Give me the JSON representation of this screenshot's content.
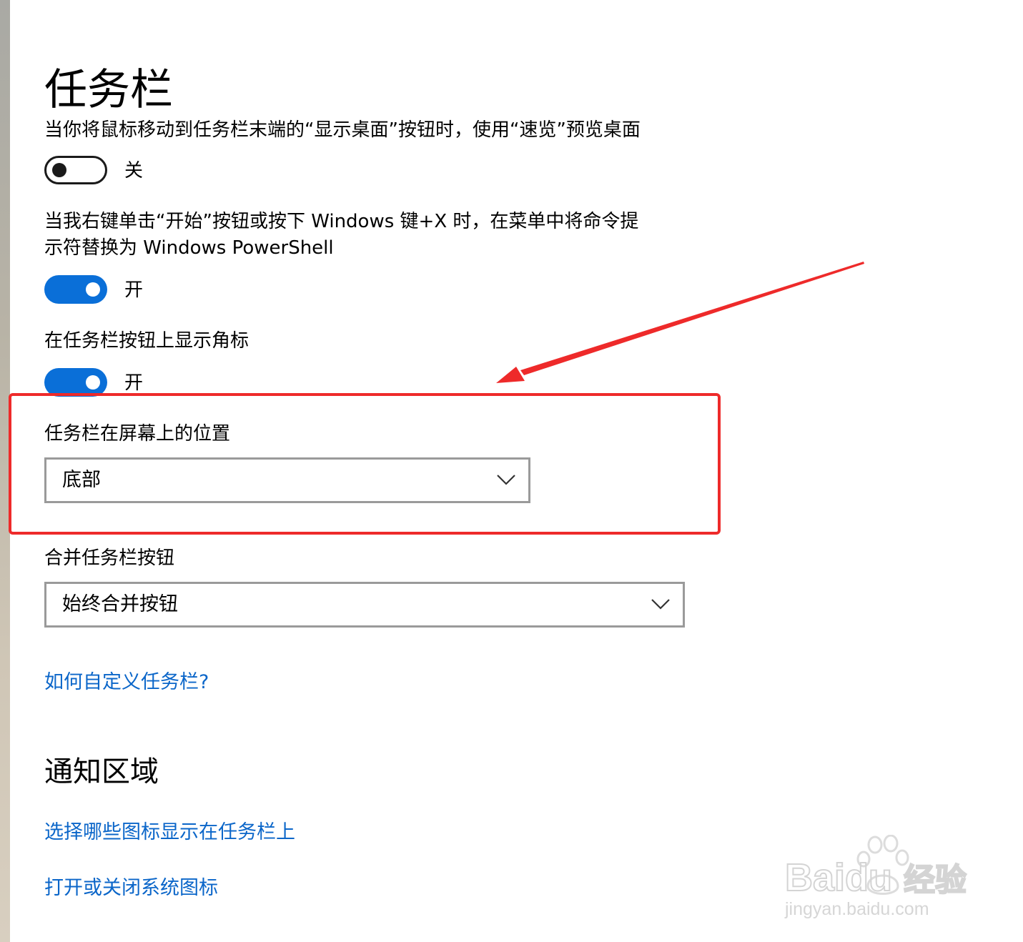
{
  "page": {
    "title": "任务栏"
  },
  "settings": {
    "peek": {
      "label": "当你将鼠标移动到任务栏末端的“显示桌面”按钮时，使用“速览”预览桌面",
      "state": "关",
      "on": false
    },
    "powershell": {
      "label_line1": "当我右键单击“开始”按钮或按下 Windows 键+X 时，在菜单中将命令提",
      "label_line2": "示符替换为 Windows PowerShell",
      "state": "开",
      "on": true
    },
    "badges": {
      "label": "在任务栏按钮上显示角标",
      "state": "开",
      "on": true
    },
    "position": {
      "label": "任务栏在屏幕上的位置",
      "value": "底部"
    },
    "combine": {
      "label": "合并任务栏按钮",
      "value": "始终合并按钮"
    },
    "help_link": "如何自定义任务栏?"
  },
  "notification_area": {
    "title": "通知区域",
    "links": [
      "选择哪些图标显示在任务栏上",
      "打开或关闭系统图标"
    ]
  },
  "annotation": {
    "color": "#ee2a2a"
  },
  "watermark": {
    "brand": "Baidu",
    "product": "经验",
    "url": "jingyan.baidu.com"
  },
  "colors": {
    "accent": "#0a6fd8",
    "link": "#0b66c9",
    "annotation": "#ee2a2a"
  }
}
